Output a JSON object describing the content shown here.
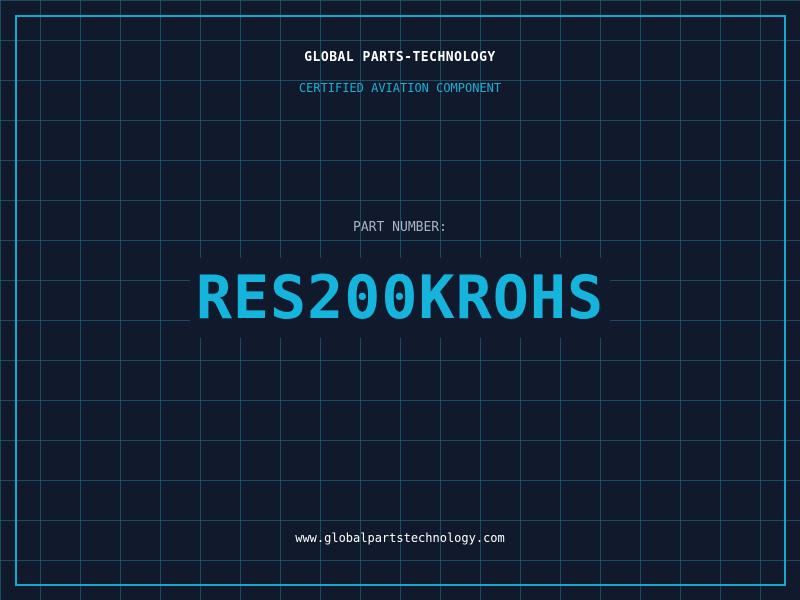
{
  "header": {
    "brand": "GLOBAL PARTS-TECHNOLOGY",
    "tagline": "CERTIFIED AVIATION COMPONENT"
  },
  "part": {
    "label": "PART NUMBER:",
    "number": "RES200KROHS"
  },
  "footer": {
    "website": "www.globalpartstechnology.com"
  },
  "colors": {
    "background": "#111a2c",
    "grid": "#20768e",
    "accent": "#14b4dc",
    "text": "#ffffff"
  }
}
